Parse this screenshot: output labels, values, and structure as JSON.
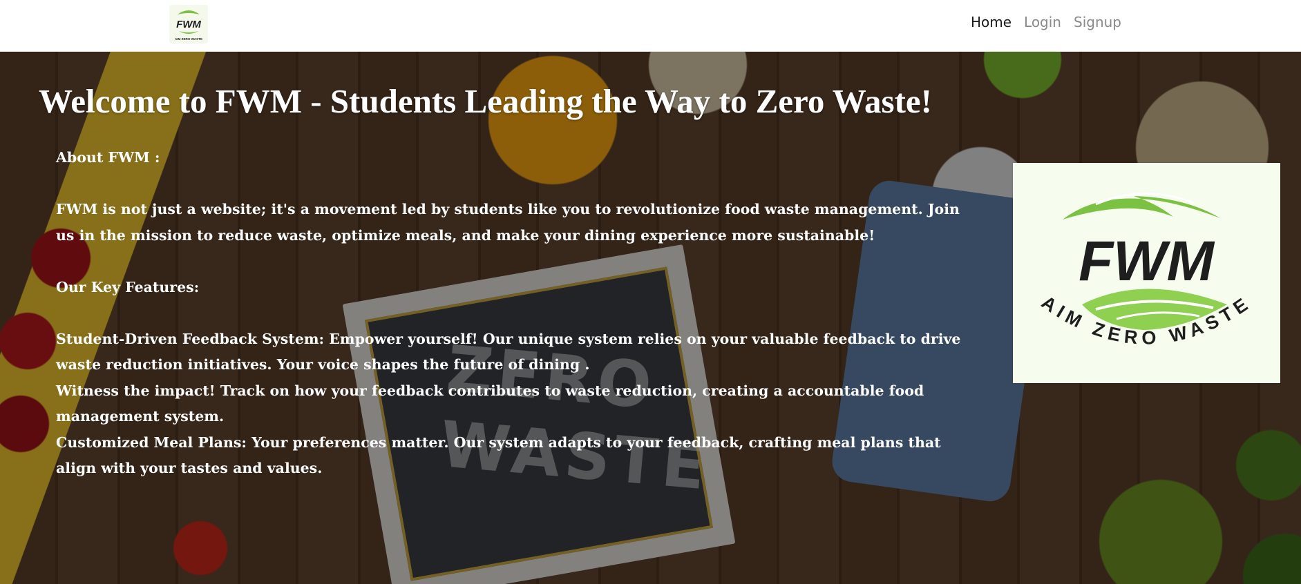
{
  "nav": {
    "logo_text": "FWM",
    "logo_tagline": "AIM ZERO WASTE",
    "links": [
      "Home",
      "Login",
      "Signup"
    ]
  },
  "hero": {
    "title": "Welcome to FWM - Students Leading the Way to Zero Waste!",
    "about_heading": "About FWM :",
    "about_text": "FWM is not just a website; it's a movement led by students like you to revolutionize food waste management. Join us in the mission to reduce waste, optimize meals, and make your dining experience more sustainable!",
    "features_heading": "Our Key Features:",
    "features": [
      "Student-Driven Feedback System: Empower yourself! Our unique system relies on your valuable feedback to drive waste reduction initiatives. Your voice shapes the future of dining .",
      "Witness the impact! Track on how your feedback contributes to waste reduction, creating a accountable food management system.",
      "Customized Meal Plans: Your preferences matter. Our system adapts to your feedback, crafting meal plans that align with your tastes and values."
    ],
    "background_chalk_text": "ZERO WASTE"
  },
  "brand_card": {
    "logo_text": "FWM",
    "tagline": "AIM ZERO WASTE"
  },
  "colors": {
    "leaf_green": "#7cc242",
    "leaf_light": "#a8dd6a",
    "logo_dark": "#1e1e1e",
    "card_bg": "#f6fdef",
    "nav_active": "#1a1a1a",
    "nav_inactive": "#8a8a8a"
  }
}
